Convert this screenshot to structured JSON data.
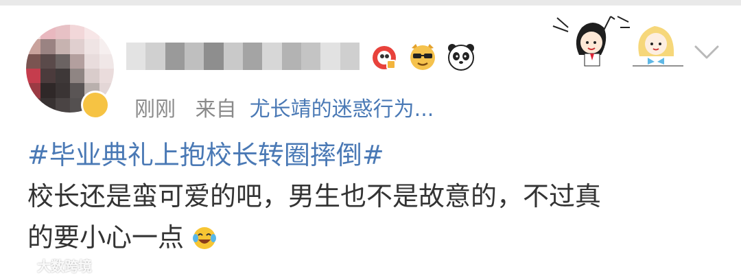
{
  "post": {
    "time": "刚刚",
    "source_prefix": "来自",
    "source_app": "尤长靖的迷惑行为...",
    "hashtag": "#毕业典礼上抱校长转圈摔倒#",
    "body_line1": "校长还是蛮可爱的吧，男生也不是故意的，不过真",
    "body_line2": "的要小心一点"
  },
  "badges": [
    "weibo-badge-icon",
    "sunglasses-dog-icon",
    "panda-icon"
  ],
  "watermark": {
    "text": "大数跨境"
  },
  "colors": {
    "link": "#4a79b5",
    "meta": "#8a8a8a",
    "body": "#333333"
  }
}
